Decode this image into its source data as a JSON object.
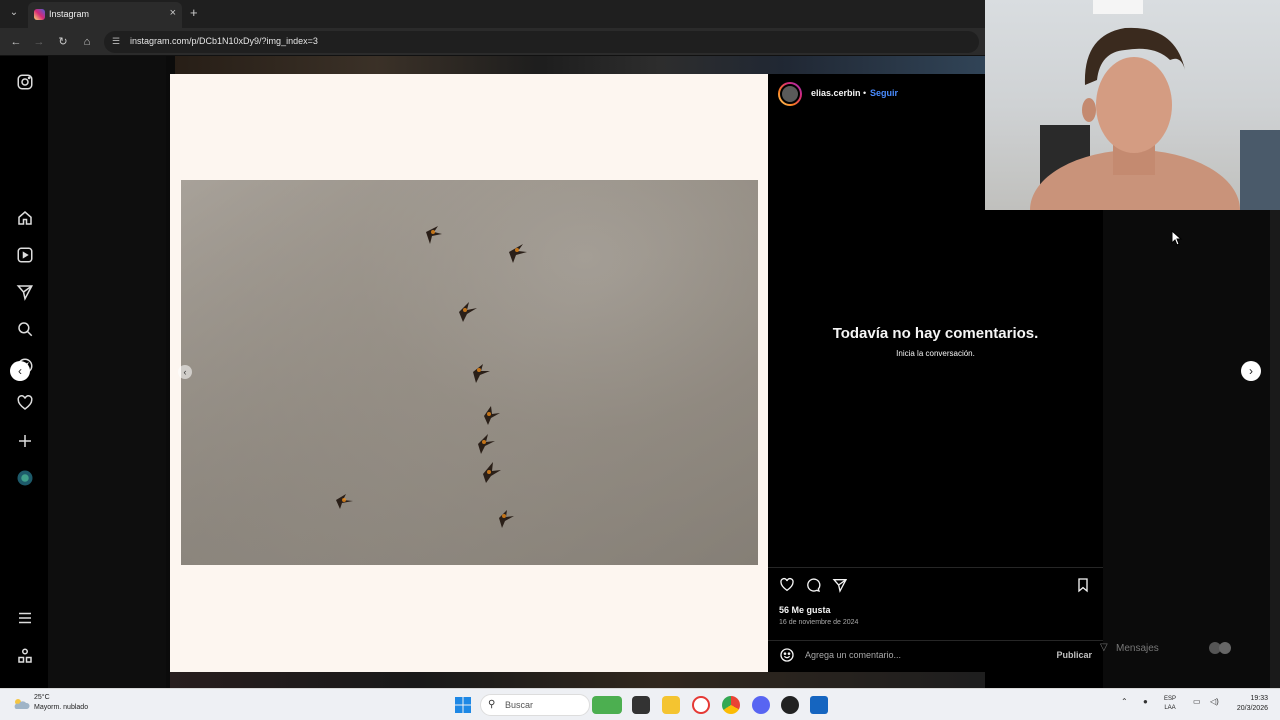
{
  "browser": {
    "tab_title": "Instagram",
    "new_tab": "+",
    "tab_close": "×",
    "url": "instagram.com/p/DCb1N10xDy9/?img_index=3"
  },
  "post": {
    "username": "elias.cerbin",
    "separator": "•",
    "follow_label": "Seguir",
    "no_comments_title": "Todavía no hay comentarios.",
    "no_comments_sub": "Inicia la conversación.",
    "likes": "56 Me gusta",
    "date": "16 de noviembre de 2024",
    "comment_placeholder": "Agrega un comentario...",
    "publish_label": "Publicar"
  },
  "messages": {
    "label": "Mensajes"
  },
  "taskbar": {
    "weather_temp": "25°C",
    "weather_desc": "Mayorm. nublado",
    "search_placeholder": "Buscar",
    "lang_top": "ESP",
    "lang_bottom": "LAA",
    "time": "19:33",
    "date": "20/3/2026"
  },
  "icons": {
    "sidebar": [
      "instagram-icon",
      "home-icon",
      "reels-icon",
      "send-icon",
      "search-icon",
      "explore-icon",
      "heart-icon",
      "create-icon",
      "profile-icon",
      "menu-icon",
      "more-icon"
    ],
    "post_actions": [
      "like-icon",
      "comment-icon",
      "share-icon",
      "save-icon"
    ]
  },
  "colors": {
    "instagram_bg": "#000000",
    "follow_blue": "#4a8cff",
    "media_bg": "#fdf6f0"
  }
}
